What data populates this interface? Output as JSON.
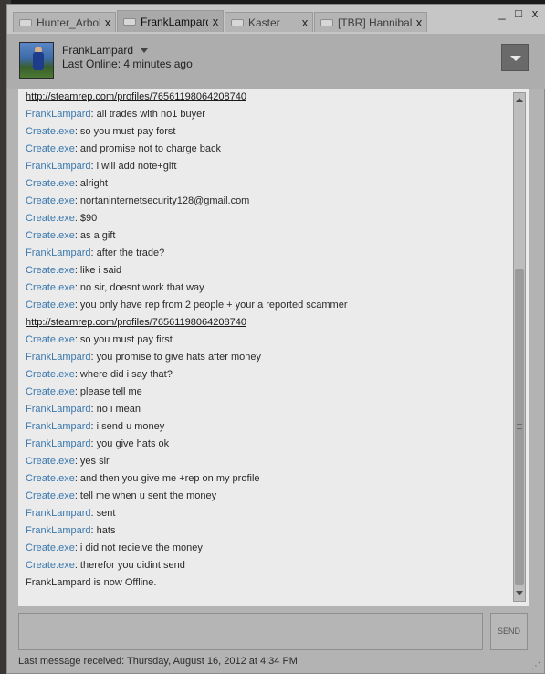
{
  "tabs": [
    {
      "label": "Hunter_Arbok",
      "close": "x"
    },
    {
      "label": "FrankLampard",
      "close": "x"
    },
    {
      "label": "Kaster",
      "close": "x"
    },
    {
      "label": "[TBR] Hannibal",
      "close": "x"
    }
  ],
  "window_controls": {
    "minimize": "_",
    "maximize": "□",
    "close": "x"
  },
  "header": {
    "friend_name": "FrankLampard",
    "last_online": "Last Online: 4 minutes ago"
  },
  "chat": {
    "messages": [
      {
        "sender": "",
        "text": "http://steamrep.com/profiles/76561198064208740",
        "link": true
      },
      {
        "sender": "FrankLampard",
        "text": ": all trades with no1 buyer"
      },
      {
        "sender": "Create.exe",
        "text": ": so you must pay forst"
      },
      {
        "sender": "Create.exe",
        "text": ": and promise not to charge back"
      },
      {
        "sender": "FrankLampard",
        "text": ": i will add note+gift"
      },
      {
        "sender": "Create.exe",
        "text": ": alright"
      },
      {
        "sender": "Create.exe",
        "text": ": nortaninternetsecurity128@gmail.com"
      },
      {
        "sender": "Create.exe",
        "text": ": $90"
      },
      {
        "sender": "Create.exe",
        "text": ": as a gift"
      },
      {
        "sender": "FrankLampard",
        "text": ": after the trade?"
      },
      {
        "sender": "Create.exe",
        "text": ": like i said"
      },
      {
        "sender": "Create.exe",
        "text": ": no sir, doesnt work that way"
      },
      {
        "sender": "Create.exe",
        "text": ": you only have rep from 2 people + your a reported scammer"
      },
      {
        "sender": "",
        "text": "http://steamrep.com/profiles/76561198064208740",
        "link": true
      },
      {
        "sender": "Create.exe",
        "text": ": so you must pay first"
      },
      {
        "sender": "FrankLampard",
        "text": ": you promise to give hats after money"
      },
      {
        "sender": "Create.exe",
        "text": ": where did i say that?"
      },
      {
        "sender": "Create.exe",
        "text": ": please tell me"
      },
      {
        "sender": "FrankLampard",
        "text": ": no i mean"
      },
      {
        "sender": "FrankLampard",
        "text": ": i send u money"
      },
      {
        "sender": "FrankLampard",
        "text": ": you give hats ok"
      },
      {
        "sender": "Create.exe",
        "text": ": yes sir"
      },
      {
        "sender": "Create.exe",
        "text": ": and then you give me +rep on my profile"
      },
      {
        "sender": "Create.exe",
        "text": ": tell me when u sent the money"
      },
      {
        "sender": "FrankLampard",
        "text": ": sent"
      },
      {
        "sender": "FrankLampard",
        "text": ": hats"
      },
      {
        "sender": "Create.exe",
        "text": ": i did not recieive the money"
      },
      {
        "sender": "Create.exe",
        "text": ": therefor you didint send"
      },
      {
        "sender": "",
        "text": "FrankLampard is now Offline."
      }
    ]
  },
  "input": {
    "send_label": "SEND"
  },
  "status": {
    "last_message": "Last message received: Thursday, August 16, 2012 at 4:34 PM"
  },
  "colors": {
    "sender_name": "#3b78ad",
    "chat_bg": "#ebebeb",
    "chrome_bg": "#b3b3b3"
  },
  "icons": {
    "tab": "chat-bubble-icon",
    "menu": "chevron-down-icon"
  }
}
